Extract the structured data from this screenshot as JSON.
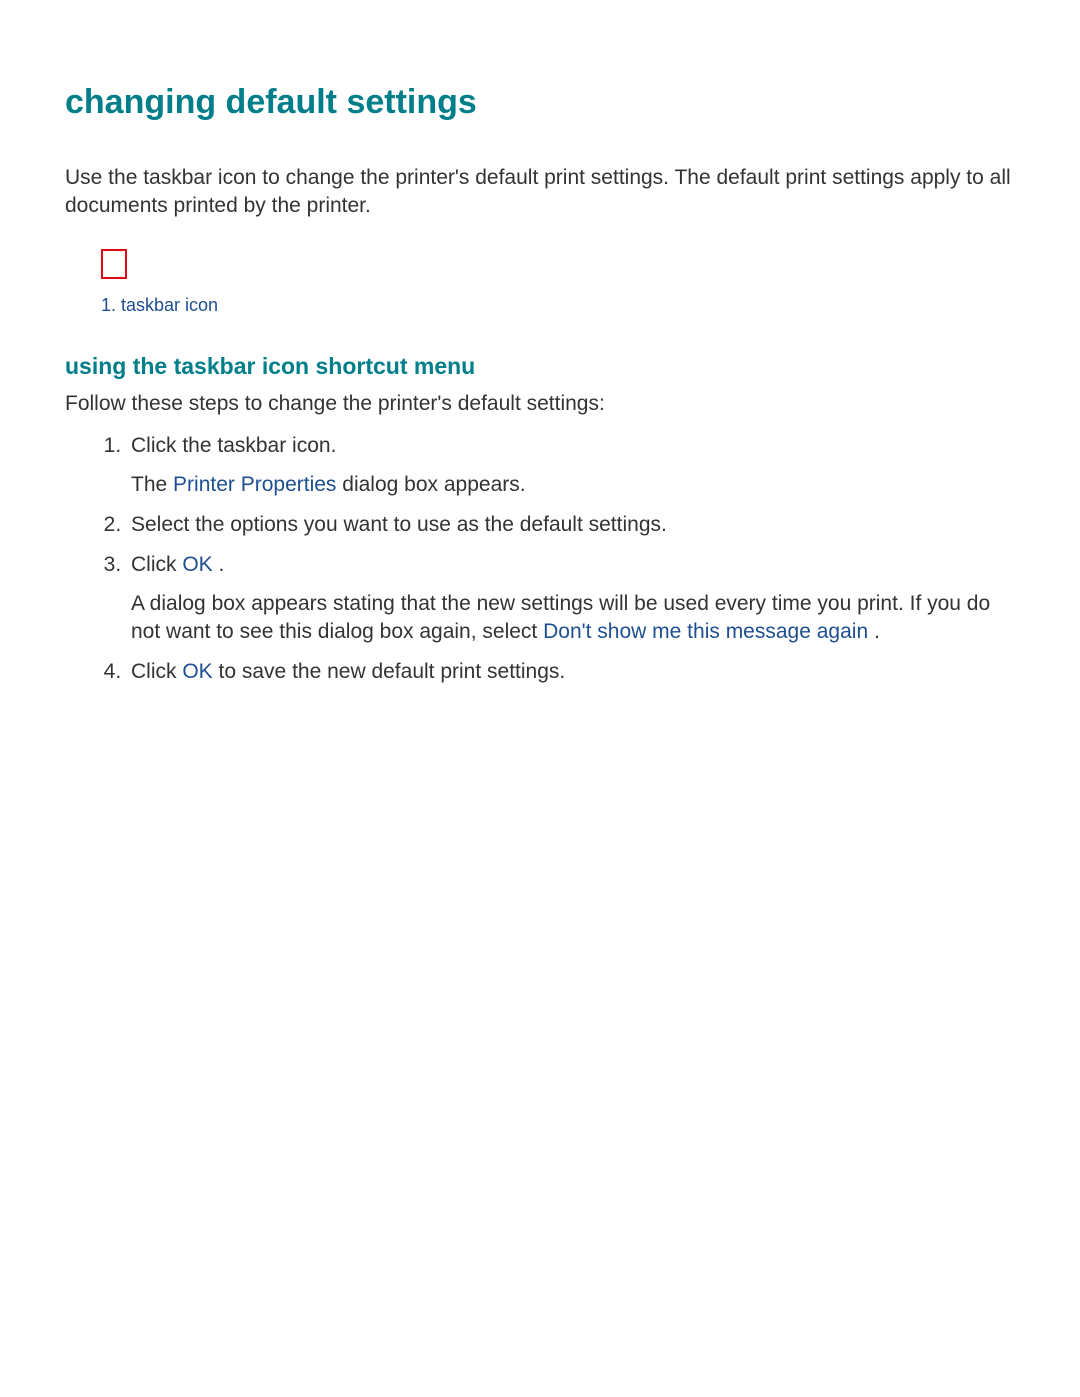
{
  "title": "changing default settings",
  "intro": "Use the taskbar icon to change the printer's default print settings. The default print settings apply to all documents printed by the printer.",
  "caption": "1. taskbar icon",
  "subheading": "using the taskbar icon shortcut menu",
  "lead_in": "Follow these steps to change the printer's default settings:",
  "steps": {
    "s1": "Click the taskbar icon.",
    "s1_sub_a": "The ",
    "s1_link": "Printer Properties",
    "s1_sub_b": " dialog box appears.",
    "s2": "Select the options you want to use as the default settings.",
    "s3_a": "Click ",
    "s3_link": "OK",
    "s3_b": " .",
    "s3_sub_a": "A dialog box appears stating that the new settings will be used every time you print. If you do not want to see this dialog box again, select ",
    "s3_sub_link": "Don't show me this message again",
    "s3_sub_b": " .",
    "s4_a": "Click ",
    "s4_link": "OK",
    "s4_b": " to save the new default print settings."
  }
}
